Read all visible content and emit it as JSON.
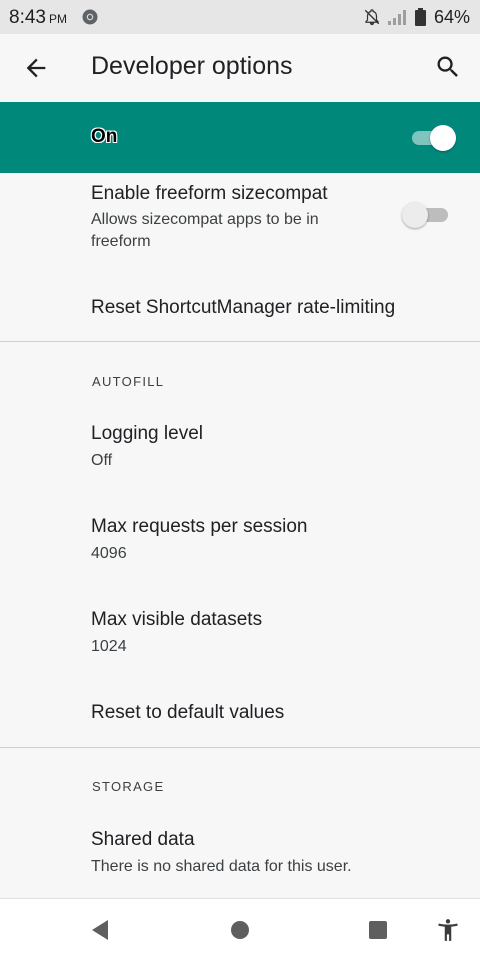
{
  "status_bar": {
    "time": "8:43",
    "ampm": "PM",
    "battery": "64%",
    "icons": [
      "chrome-icon",
      "notifications-off-icon",
      "signal-icon",
      "battery-icon"
    ]
  },
  "app_bar": {
    "title": "Developer options",
    "back_icon": "arrow-left-icon",
    "search_icon": "search-icon"
  },
  "master_switch": {
    "label": "On",
    "state": "on",
    "background": "#00897b"
  },
  "settings": {
    "freeform": {
      "title": "Enable freeform sizecompat",
      "summary": "Allows sizecompat apps to be in freeform",
      "toggle_state": "off"
    },
    "reset_shortcut": {
      "title": "Reset ShortcutManager rate-limiting"
    },
    "autofill": {
      "header": "AUTOFILL",
      "logging_level": {
        "title": "Logging level",
        "value": "Off"
      },
      "max_requests": {
        "title": "Max requests per session",
        "value": "4096"
      },
      "max_datasets": {
        "title": "Max visible datasets",
        "value": "1024"
      },
      "reset_defaults": {
        "title": "Reset to default values"
      }
    },
    "storage": {
      "header": "STORAGE",
      "shared_data": {
        "title": "Shared data",
        "summary": "There is no shared data for this user."
      }
    }
  },
  "nav_bar": {
    "buttons": [
      "back-triangle-icon",
      "home-circle-icon",
      "recents-square-icon",
      "accessibility-icon"
    ]
  }
}
